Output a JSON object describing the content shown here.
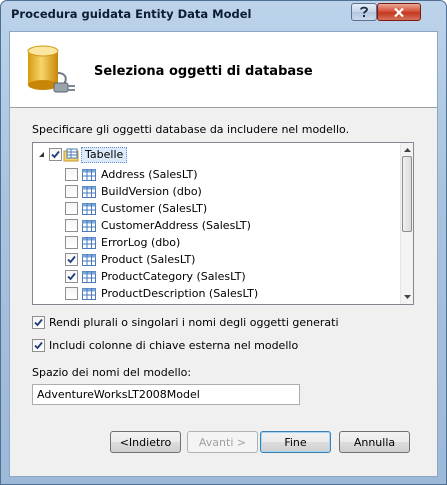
{
  "window": {
    "title": "Procedura guidata Entity Data Model"
  },
  "header": {
    "title": "Seleziona oggetti di database",
    "icon": "database-plug-icon"
  },
  "instruction": "Specificare gli oggetti database da includere nel modello.",
  "tree": {
    "root": {
      "label": "Tabelle",
      "checked": true,
      "expanded": true
    },
    "items": [
      {
        "label": "Address (SalesLT)",
        "checked": false
      },
      {
        "label": "BuildVersion (dbo)",
        "checked": false
      },
      {
        "label": "Customer (SalesLT)",
        "checked": false
      },
      {
        "label": "CustomerAddress (SalesLT)",
        "checked": false
      },
      {
        "label": "ErrorLog (dbo)",
        "checked": false
      },
      {
        "label": "Product (SalesLT)",
        "checked": true
      },
      {
        "label": "ProductCategory (SalesLT)",
        "checked": true
      },
      {
        "label": "ProductDescription (SalesLT)",
        "checked": false
      }
    ]
  },
  "options": {
    "pluralize_label": "Rendi plurali o singolari i nomi degli oggetti generati",
    "pluralize_checked": true,
    "foreign_keys_label": "Includi colonne di chiave esterna nel modello",
    "foreign_keys_checked": true
  },
  "namespace": {
    "label": "Spazio dei nomi del modello:",
    "value": "AdventureWorksLT2008Model"
  },
  "buttons": {
    "back": "<Indietro",
    "next": "Avanti >",
    "finish": "Fine",
    "cancel": "Annulla"
  },
  "colors": {
    "check": "#1f3f7a",
    "header_bg": "#ffffff",
    "dialog_bg": "#f0f0f0"
  }
}
